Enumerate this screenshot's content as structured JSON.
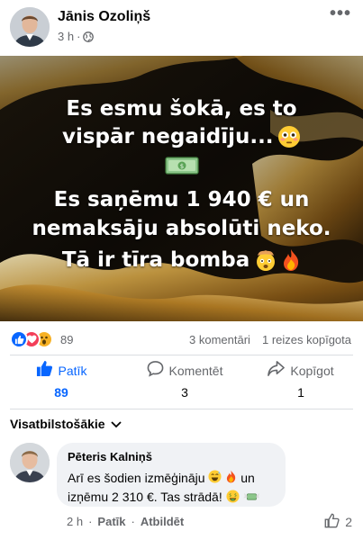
{
  "post": {
    "author": "Jānis Ozoliņš",
    "time": "3 h",
    "separator": "·",
    "privacy_icon": "globe-icon",
    "more_icon": "more-horizontal-icon",
    "more_label": "•••"
  },
  "image": {
    "line1": "Es esmu šokā, es to",
    "line2": "vispār negaidīju...",
    "line3": "Es saņēmu 1 940 € un",
    "line4": "nemaksāju absolūti neko.",
    "line5": "Tā ir tīra bomba",
    "emojis": [
      "flushed-face",
      "dollar-banknote",
      "exploding-head",
      "fire"
    ]
  },
  "stats": {
    "reactions": [
      "like",
      "love",
      "wow"
    ],
    "reaction_count": "89",
    "comments": "3 komentāri",
    "shares": "1 reizes kopīgota"
  },
  "actions": {
    "like": {
      "label": "Patīk",
      "count": "89"
    },
    "comment": {
      "label": "Komentēt",
      "count": "3"
    },
    "share": {
      "label": "Kopīgot",
      "count": "1"
    }
  },
  "comments_sort": "Visatbilstošākie",
  "comment": {
    "author": "Pēteris Kalniņš",
    "text_a": "Arī es šodien izmēģināju",
    "text_b": "un",
    "text_c": "izņēmu 2 310 €. Tas strādā!",
    "time": "2 h",
    "like_action": "Patīk",
    "reply_action": "Atbildēt",
    "like_count": "2"
  },
  "colors": {
    "accent": "#0866ff",
    "secondary_text": "#65676b",
    "bubble": "#f0f2f5",
    "love": "#f33e58",
    "wow": "#f7b125"
  }
}
